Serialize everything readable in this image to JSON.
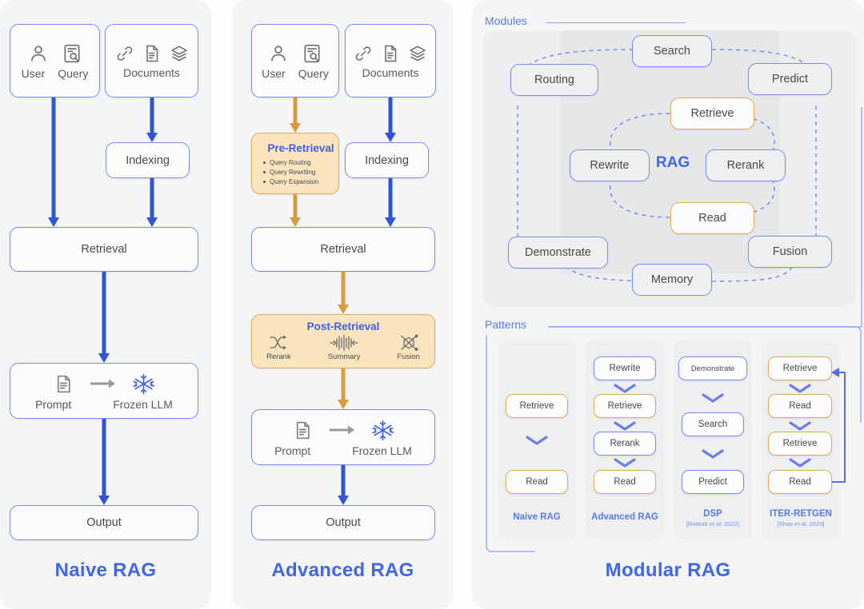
{
  "meta": {
    "colors": {
      "blue": "#2f55d4",
      "accent_blue": "#3f67e8",
      "amber": "#d99a3f",
      "amber_fill": "#fae4bd",
      "panel_bg": "#f4f5f7",
      "node_border_blue": "#7b8bf0"
    }
  },
  "naive": {
    "title": "Naive RAG",
    "user_query": {
      "user": "User",
      "query": "Query"
    },
    "documents": {
      "label": "Documents"
    },
    "indexing": "Indexing",
    "retrieval": "Retrieval",
    "generation": {
      "prompt": "Prompt",
      "llm": "Frozen LLM"
    },
    "output": "Output"
  },
  "advanced": {
    "title": "Advanced RAG",
    "user_query": {
      "user": "User",
      "query": "Query"
    },
    "documents": {
      "label": "Documents"
    },
    "pre_retrieval": {
      "title": "Pre-Retrieval",
      "items": [
        "Query Routing",
        "Query Rewriting",
        "Query Expansion"
      ]
    },
    "indexing": "Indexing",
    "retrieval": "Retrieval",
    "post_retrieval": {
      "title": "Post-Retrieval",
      "items": [
        "Rerank",
        "Summary",
        "Fusion"
      ]
    },
    "generation": {
      "prompt": "Prompt",
      "llm": "Frozen LLM"
    },
    "output": "Output"
  },
  "modular": {
    "title": "Modular RAG",
    "modules": {
      "label": "Modules",
      "center": "RAG",
      "nodes": [
        {
          "id": "search",
          "label": "Search",
          "style": "blue"
        },
        {
          "id": "routing",
          "label": "Routing",
          "style": "blue"
        },
        {
          "id": "predict",
          "label": "Predict",
          "style": "blue"
        },
        {
          "id": "retrieve",
          "label": "Retrieve",
          "style": "amber"
        },
        {
          "id": "rewrite",
          "label": "Rewrite",
          "style": "blue"
        },
        {
          "id": "rerank",
          "label": "Rerank",
          "style": "blue"
        },
        {
          "id": "read",
          "label": "Read",
          "style": "amber"
        },
        {
          "id": "demonstrate",
          "label": "Demonstrate",
          "style": "blue"
        },
        {
          "id": "fusion",
          "label": "Fusion",
          "style": "blue"
        },
        {
          "id": "memory",
          "label": "Memory",
          "style": "blue"
        }
      ]
    },
    "patterns": {
      "label": "Patterns",
      "cards": [
        {
          "id": "naive-rag",
          "caption": "Naive RAG",
          "citation": "",
          "steps": [
            {
              "label": "Retrieve",
              "style": "amber"
            },
            {
              "label": "Read",
              "style": "amber"
            }
          ]
        },
        {
          "id": "advanced-rag",
          "caption": "Advanced RAG",
          "citation": "",
          "steps": [
            {
              "label": "Rewrite",
              "style": "blue"
            },
            {
              "label": "Retrieve",
              "style": "amber"
            },
            {
              "label": "Rerank",
              "style": "blue"
            },
            {
              "label": "Read",
              "style": "amber"
            }
          ]
        },
        {
          "id": "dsp",
          "caption": "DSP",
          "citation": "[khattab et al. 2022]",
          "steps": [
            {
              "label": "Demonstrate",
              "style": "blue"
            },
            {
              "label": "Search",
              "style": "blue"
            },
            {
              "label": "Predict",
              "style": "blue"
            }
          ]
        },
        {
          "id": "iter-retgen",
          "caption": "ITER-RETGEN",
          "citation": "[Shao et al. 2023]",
          "steps": [
            {
              "label": "Retrieve",
              "style": "amber"
            },
            {
              "label": "Read",
              "style": "amber"
            },
            {
              "label": "Retrieve",
              "style": "amber"
            },
            {
              "label": "Read",
              "style": "amber"
            }
          ]
        }
      ]
    }
  }
}
